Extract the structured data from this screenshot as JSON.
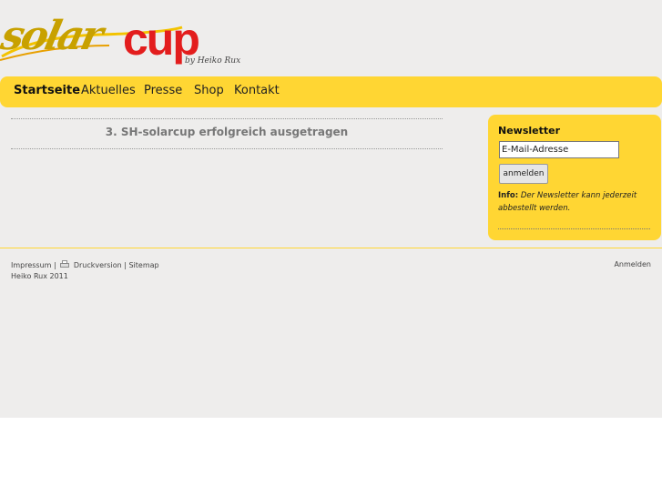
{
  "logo": {
    "script_text": "solar",
    "cup_text": "cup",
    "byline": "by Heiko Rux"
  },
  "nav": {
    "items": [
      {
        "label": "Startseite",
        "active": true
      },
      {
        "label": "Aktuelles",
        "active": false
      },
      {
        "label": "Presse",
        "active": false
      },
      {
        "label": "Shop",
        "active": false
      },
      {
        "label": "Kontakt",
        "active": false
      }
    ]
  },
  "main": {
    "headline": "3. SH-solarcup erfolgreich ausgetragen"
  },
  "sidebar": {
    "title": "Newsletter",
    "email_value": "E-Mail-Adresse",
    "button_label": "anmelden",
    "info_label": "Info:",
    "info_text": "Der Newsletter kann jederzeit abbestellt werden."
  },
  "footer": {
    "impressum": "Impressum",
    "separator": "|",
    "druckversion": "Druckversion",
    "sitemap": "Sitemap",
    "copyright": "Heiko Rux 2011",
    "login": "Anmelden"
  },
  "colors": {
    "accent": "#ffd633",
    "background": "#eeedec",
    "logo_red": "#e31d1d",
    "logo_gold": "#c8a100"
  }
}
